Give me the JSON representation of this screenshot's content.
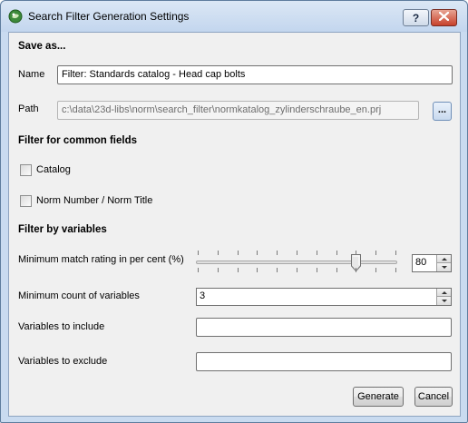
{
  "window": {
    "title": "Search Filter Generation Settings"
  },
  "titlebar": {
    "help_label": "?"
  },
  "icons": {
    "app": "app-logo-icon",
    "close": "close-icon",
    "help": "question-mark-icon",
    "browse": "ellipsis-icon"
  },
  "save_as": {
    "heading": "Save as...",
    "name_label": "Name",
    "name_value": "Filter: Standards catalog - Head cap bolts",
    "path_label": "Path",
    "path_value": "c:\\data\\23d-libs\\norm\\search_filter\\normkatalog_zylinderschraube_en.prj",
    "browse_label": "..."
  },
  "common_fields": {
    "heading": "Filter for common fields",
    "catalog_label": "Catalog",
    "catalog_checked": false,
    "norm_label": "Norm Number / Norm Title",
    "norm_checked": false
  },
  "variables": {
    "heading": "Filter by variables",
    "match_label": "Minimum match rating in per cent (%)",
    "match_value": "80",
    "match_percent": 80,
    "count_label": "Minimum count of variables",
    "count_value": "3",
    "include_label": "Variables to include",
    "include_value": "",
    "exclude_label": "Variables to exclude",
    "exclude_value": ""
  },
  "buttons": {
    "generate": "Generate",
    "cancel": "Cancel"
  }
}
